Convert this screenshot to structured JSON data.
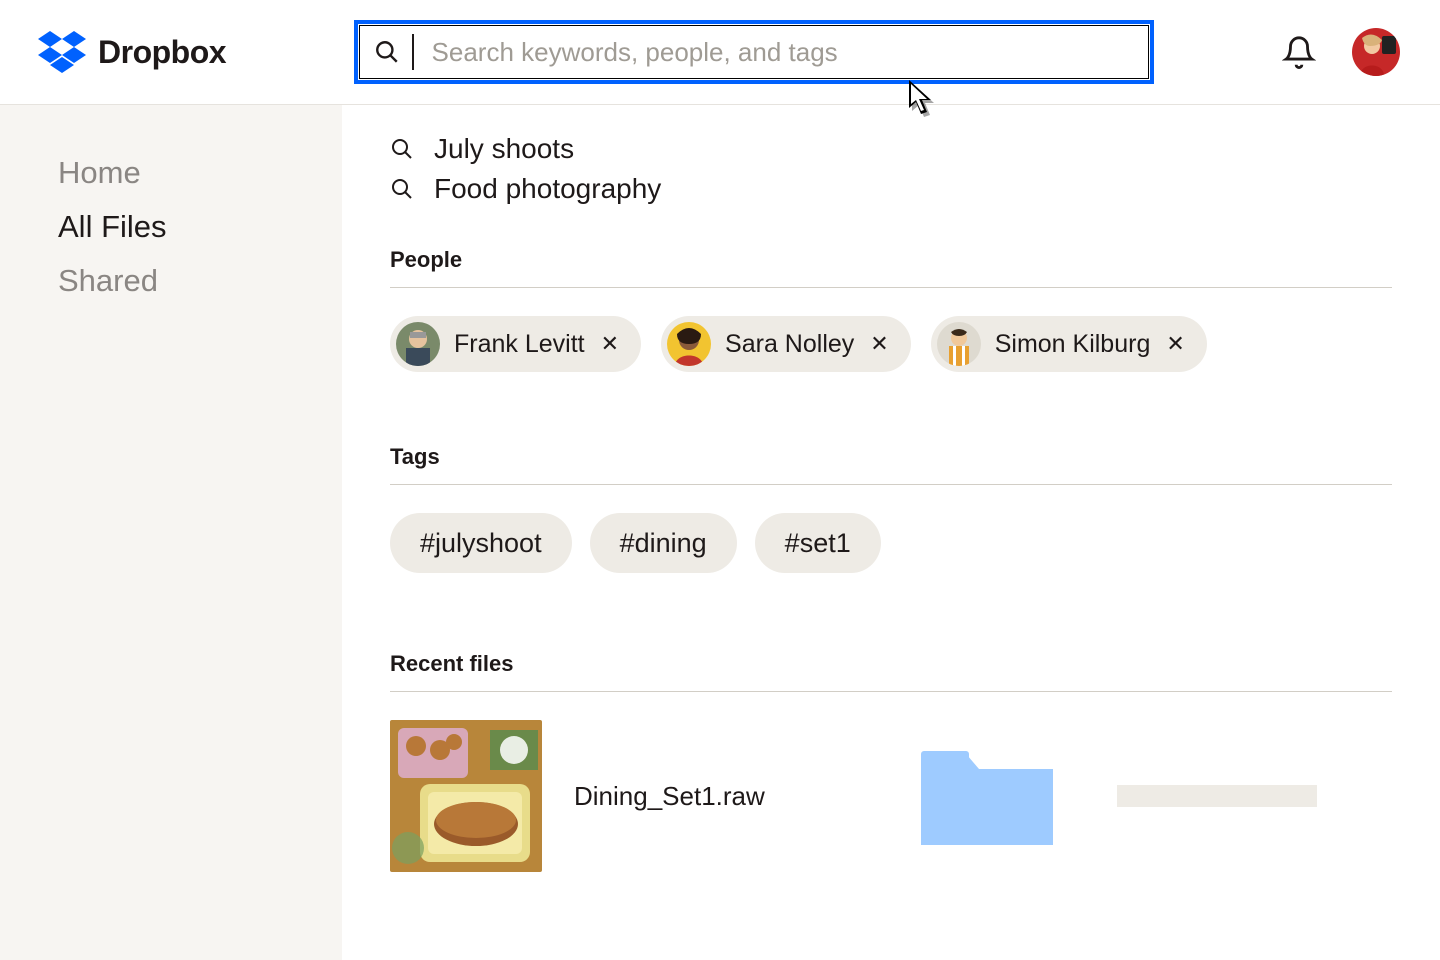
{
  "brand": {
    "name": "Dropbox"
  },
  "search": {
    "placeholder": "Search keywords, people, and tags"
  },
  "sidebar": {
    "items": [
      "Home",
      "All Files",
      "Shared"
    ],
    "active_index": 1
  },
  "suggestions": [
    "July shoots",
    "Food photography"
  ],
  "sections": {
    "people_header": "People",
    "tags_header": "Tags",
    "recent_header": "Recent files"
  },
  "people": [
    {
      "name": "Frank Levitt"
    },
    {
      "name": "Sara Nolley"
    },
    {
      "name": "Simon Kilburg"
    }
  ],
  "tags": [
    "#julyshoot",
    "#dining",
    "#set1"
  ],
  "recent_files": [
    {
      "name": "Dining_Set1.raw"
    }
  ]
}
